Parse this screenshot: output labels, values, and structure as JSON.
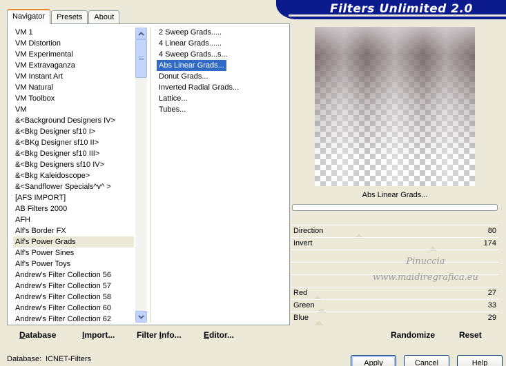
{
  "banner": {
    "title": "Filters Unlimited 2.0"
  },
  "tabs": [
    {
      "label": "Navigator",
      "active": true
    },
    {
      "label": "Presets",
      "active": false
    },
    {
      "label": "About",
      "active": false
    }
  ],
  "categories": [
    "VM 1",
    "VM Distortion",
    "VM Experimental",
    "VM Extravaganza",
    "VM Instant Art",
    "VM Natural",
    "VM Toolbox",
    "VM",
    "&<Background Designers IV>",
    "&<Bkg Designer sf10 I>",
    "&<BKg Designer sf10 II>",
    "&<Bkg Designer sf10 III>",
    "&<Bkg Designers sf10 IV>",
    "&<Bkg Kaleidoscope>",
    "&<Sandflower Specials^v^ >",
    "[AFS IMPORT]",
    "AB Filters 2000",
    "AFH",
    "Alf's Border FX",
    "Alf's Power Grads",
    "Alf's Power Sines",
    "Alf's Power Toys",
    "Andrew's Filter Collection 56",
    "Andrew's Filter Collection 57",
    "Andrew's Filter Collection 58",
    "Andrew's Filter Collection 60",
    "Andrew's Filter Collection 62"
  ],
  "selected_category": "Alf's Power Grads",
  "filters": [
    "2 Sweep Grads.....",
    "4 Linear Grads......",
    "4 Sweep Grads...s...",
    "Abs Linear Grads...",
    "Donut Grads...",
    "Inverted Radial Grads...",
    "Lattice...",
    "Tubes..."
  ],
  "selected_filter": "Abs Linear Grads...",
  "preview": {
    "filter_name": "Abs Linear Grads...",
    "progress": 0
  },
  "params": [
    {
      "label": "Direction",
      "value": "80",
      "slider_fraction": 0.314
    },
    {
      "label": "Invert",
      "value": "174",
      "slider_fraction": 0.682
    },
    {
      "label": "Red",
      "value": "27",
      "slider_fraction": 0.106
    },
    {
      "label": "Green",
      "value": "33",
      "slider_fraction": 0.129
    },
    {
      "label": "Blue",
      "value": "29",
      "slider_fraction": 0.114
    }
  ],
  "watermark": {
    "line1": "Pinuccia",
    "line2": "www.maidiregrafica.eu"
  },
  "buttons": {
    "database": {
      "ul": "D",
      "rest": "atabase"
    },
    "import": {
      "ul": "I",
      "rest": "mport..."
    },
    "filter_info": {
      "pre": "Filter ",
      "ul": "I",
      "rest": "nfo..."
    },
    "editor": {
      "ul": "E",
      "rest": "ditor..."
    },
    "randomize": "Randomize",
    "reset": "Reset",
    "apply": "Apply",
    "cancel": "Cancel",
    "help": "Help"
  },
  "status": {
    "database_label": "Database:",
    "database_value": "ICNET-Filters"
  },
  "colors": {
    "banner": "#0b1a8c",
    "selection": "#316ac5",
    "dialog": "#ece9d8"
  }
}
